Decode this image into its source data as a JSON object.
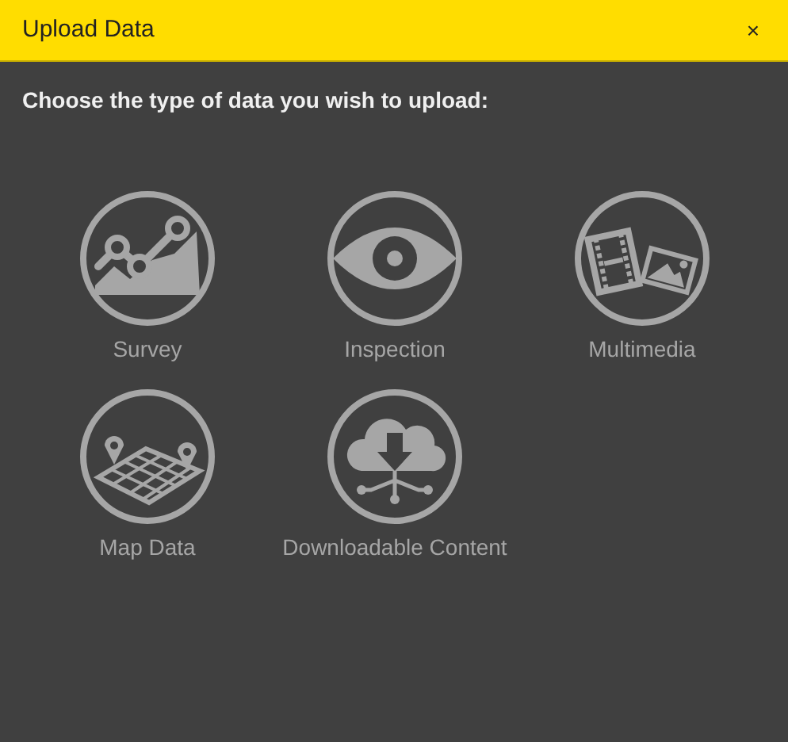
{
  "window": {
    "title": "Upload Data",
    "close": "×"
  },
  "prompt": "Choose the type of data you wish to upload:",
  "options": [
    {
      "kind": "survey",
      "label": "Survey"
    },
    {
      "kind": "inspection",
      "label": "Inspection"
    },
    {
      "kind": "multimedia",
      "label": "Multimedia"
    },
    {
      "kind": "map",
      "label": "Map Data"
    },
    {
      "kind": "download",
      "label": "Downloadable Content"
    }
  ]
}
